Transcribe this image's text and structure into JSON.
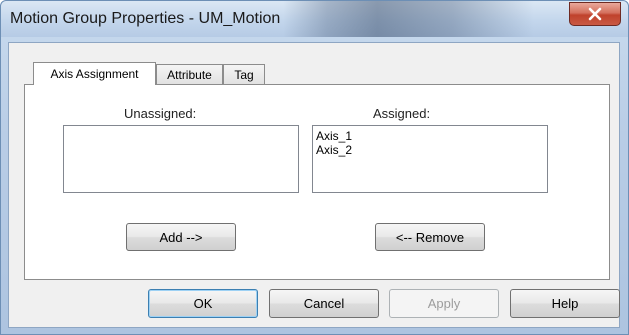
{
  "window": {
    "title": "Motion Group Properties - UM_Motion"
  },
  "tabs": [
    {
      "label": "Axis Assignment",
      "active": true
    },
    {
      "label": "Attribute",
      "active": false
    },
    {
      "label": "Tag",
      "active": false
    }
  ],
  "axis_assignment": {
    "unassigned_label": "Unassigned:",
    "assigned_label": "Assigned:",
    "unassigned_items": [],
    "assigned_items": [
      "Axis_1",
      "Axis_2"
    ],
    "add_label": "Add -->",
    "remove_label": "<-- Remove"
  },
  "buttons": {
    "ok": "OK",
    "cancel": "Cancel",
    "apply": "Apply",
    "help": "Help"
  },
  "colors": {
    "close_button": "#c7493a",
    "default_button_border": "#3c7fb1"
  }
}
